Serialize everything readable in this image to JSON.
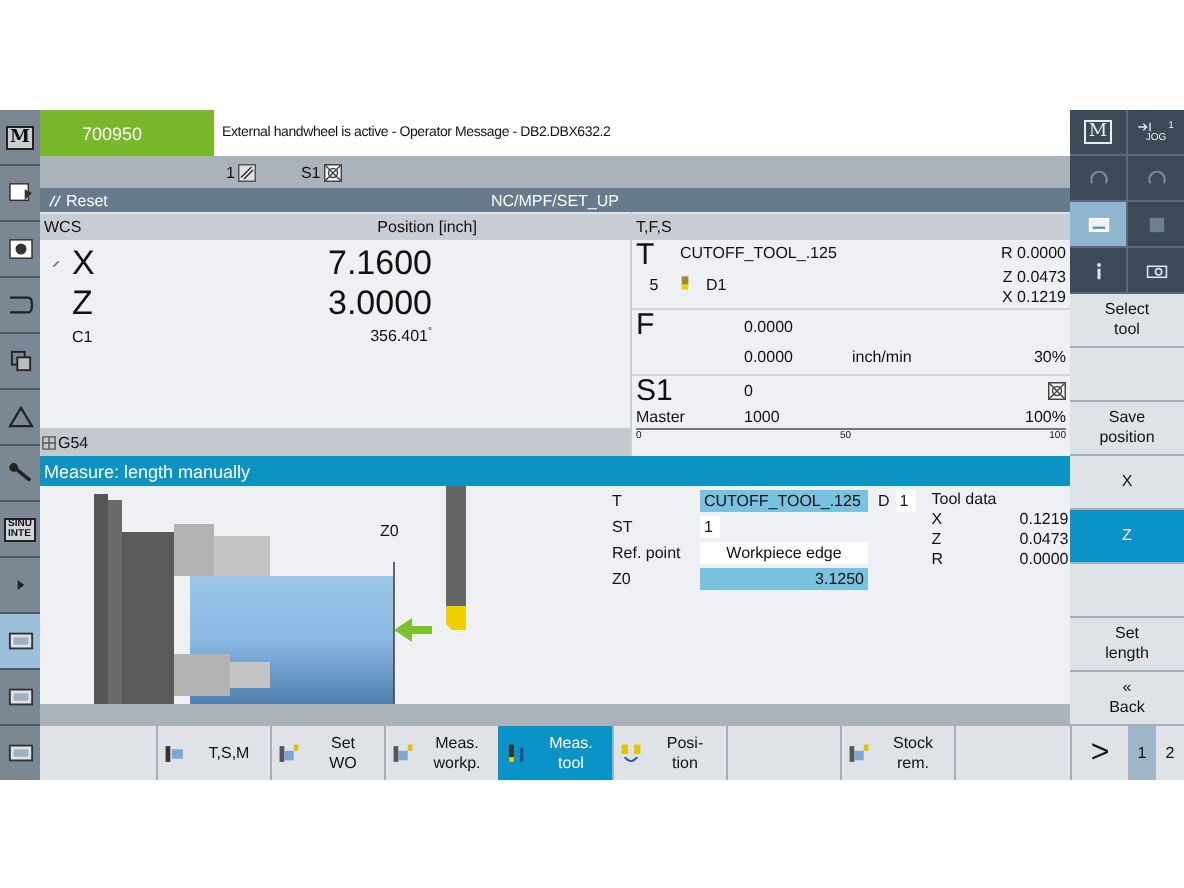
{
  "left_nav": [
    {
      "kind": "m",
      "label": "M",
      "selected": false
    },
    {
      "kind": "program",
      "selected": false
    },
    {
      "kind": "machine",
      "selected": false
    },
    {
      "kind": "parameter",
      "selected": false
    },
    {
      "kind": "copy",
      "selected": false
    },
    {
      "kind": "alarm",
      "selected": false
    },
    {
      "kind": "wrench",
      "selected": false
    },
    {
      "kind": "sinumerik",
      "lines": [
        "SINU",
        "INTE"
      ],
      "selected": false
    },
    {
      "kind": "expand",
      "selected": false
    },
    {
      "kind": "screen",
      "selected": true
    },
    {
      "kind": "screen",
      "selected": false
    },
    {
      "kind": "screen",
      "selected": false
    }
  ],
  "alarm": {
    "number": "700950",
    "message": "External handwheel is active - Operator Message - DB2.DBX632.2"
  },
  "channel_status": [
    {
      "label": "1",
      "kind": "handwheel"
    },
    {
      "label": "S1",
      "kind": "spindle"
    }
  ],
  "status_bar": {
    "state": "Reset",
    "program": "NC/MPF/SET_UP"
  },
  "positions": {
    "header": [
      "WCS",
      "Position [inch]"
    ],
    "axes": [
      {
        "name": "X",
        "value": "7.1600",
        "kind": "linear",
        "handwheel": true
      },
      {
        "name": "Z",
        "value": "3.0000",
        "kind": "linear",
        "handwheel": false
      },
      {
        "name": "C1",
        "value": "356.401",
        "unit": "°",
        "kind": "rotary",
        "handwheel": false
      }
    ],
    "footer": "G54"
  },
  "tfs": {
    "header": "T,F,S",
    "tool": {
      "letter": "T",
      "name": "CUTOFF_TOOL_.125",
      "place": "5",
      "edge": "D1",
      "offsets": [
        "R 0.0000",
        "Z 0.0473",
        "X 0.1219"
      ]
    },
    "feed": {
      "letter": "F",
      "actual": "0.0000",
      "set": "0.0000",
      "unit": "inch/min",
      "override": "30%"
    },
    "spindle": {
      "letter": "S1",
      "actual": "0",
      "label": "Master",
      "set": "1000",
      "override": "100%",
      "scale": [
        "0",
        "50",
        "100"
      ]
    }
  },
  "measure": {
    "title": "Measure: length manually",
    "z0_label": "Z0",
    "form": {
      "t_label": "T",
      "tool": "CUTOFF_TOOL_.125",
      "d_label": "D",
      "d": "1",
      "st_label": "ST",
      "st": "1",
      "ref_label": "Ref. point",
      "ref": "Workpiece edge",
      "z0_label": "Z0",
      "z0": "3.1250"
    },
    "tool_data": {
      "title": "Tool data",
      "rows": [
        {
          "axis": "X",
          "value": "0.1219"
        },
        {
          "axis": "Z",
          "value": "0.0473"
        },
        {
          "axis": "R",
          "value": "0.0000"
        }
      ]
    }
  },
  "top_keys": {
    "m_label": "M",
    "jog_channel": "1",
    "jog_label": "JOG"
  },
  "vertical_softkeys": [
    {
      "kind": "key",
      "lines": [
        "Select",
        "tool"
      ],
      "selected": false
    },
    {
      "kind": "blank",
      "selected": false
    },
    {
      "kind": "key",
      "lines": [
        "Save",
        "position"
      ],
      "selected": false
    },
    {
      "kind": "key",
      "lines": [
        "X"
      ],
      "selected": false
    },
    {
      "kind": "key",
      "lines": [
        "Z"
      ],
      "selected": true
    },
    {
      "kind": "blank",
      "selected": false
    },
    {
      "kind": "key",
      "lines": [
        "Set",
        "length"
      ],
      "selected": false
    },
    {
      "kind": "back",
      "glyph": "«",
      "lines": [
        "Back"
      ],
      "selected": false
    }
  ],
  "horizontal_softkeys": [
    {
      "kind": "key",
      "lines": [
        "T,S,M"
      ],
      "selected": false
    },
    {
      "kind": "key",
      "lines": [
        "Set",
        "WO"
      ],
      "selected": false
    },
    {
      "kind": "key",
      "lines": [
        "Meas.",
        "workp."
      ],
      "selected": false
    },
    {
      "kind": "key",
      "lines": [
        "Meas.",
        "tool"
      ],
      "selected": true
    },
    {
      "kind": "key",
      "lines": [
        "Posi-",
        "tion"
      ],
      "selected": false
    },
    {
      "kind": "blank",
      "selected": false
    },
    {
      "kind": "key",
      "lines": [
        "Stock",
        "rem."
      ],
      "selected": false
    },
    {
      "kind": "blank",
      "selected": false
    }
  ],
  "pager": {
    "glyph": ">",
    "pages": [
      {
        "label": "1",
        "selected": true
      },
      {
        "label": "2",
        "selected": false
      }
    ]
  }
}
